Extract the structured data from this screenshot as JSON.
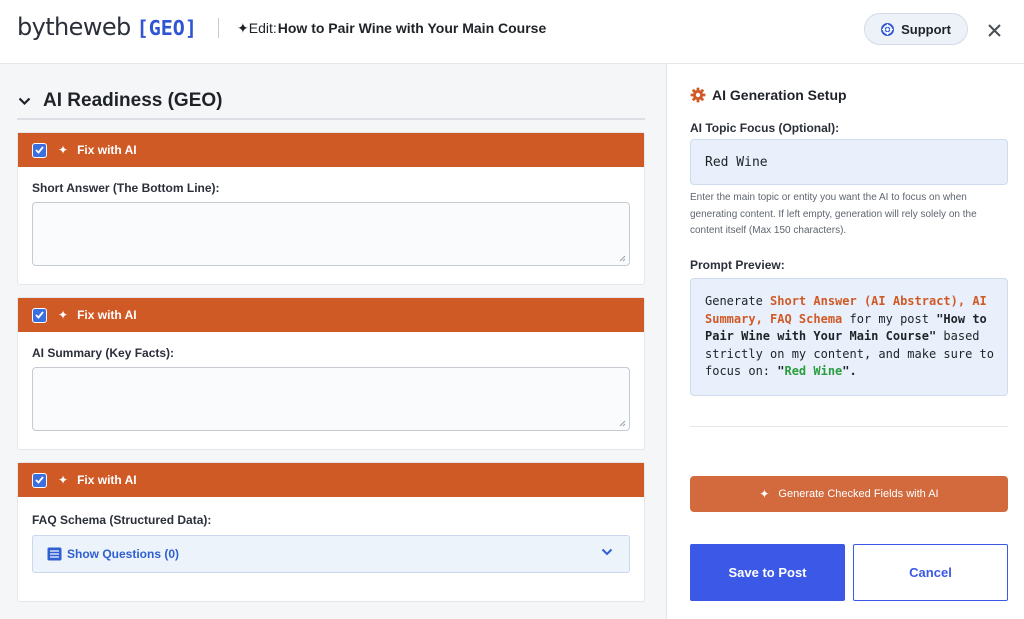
{
  "header": {
    "logo_text": "bytheweb",
    "logo_badge": "[GEO]",
    "title_prefix": "✦Edit:",
    "title": "How to Pair Wine with Your Main Course",
    "support_label": "Support",
    "support_icon": "lifebuoy-icon",
    "close_icon": "close-icon"
  },
  "left": {
    "section_title": "AI Readiness (GEO)",
    "cards": [
      {
        "fix_label": "Fix with AI",
        "checked": true,
        "field_label": "Short Answer (The Bottom Line):",
        "value": ""
      },
      {
        "fix_label": "Fix with AI",
        "checked": true,
        "field_label": "AI Summary (Key Facts):",
        "value": ""
      },
      {
        "fix_label": "Fix with AI",
        "checked": true,
        "field_label": "FAQ Schema (Structured Data):",
        "questions_label": "Show Questions (0)"
      }
    ]
  },
  "right": {
    "title": "AI Generation Setup",
    "topic_label": "AI Topic Focus (Optional):",
    "topic_value": "Red Wine",
    "help_text": "Enter the main topic or entity you want the AI to focus on when generating content. If left empty, generation will rely solely on the content itself (Max 150 characters).",
    "preview_label": "Prompt Preview:",
    "preview": {
      "p1": "Generate ",
      "fields": "Short Answer (AI Abstract), AI Summary, FAQ Schema",
      "p2": " for my post ",
      "post": "\"How to Pair Wine with Your Main Course\"",
      "p3": " based strictly on my content, and make sure to focus on: ",
      "q_open": "\"",
      "topic": "Red Wine",
      "q_close": "\".",
      "p4": ""
    },
    "generate_label": "Generate Checked Fields with AI",
    "save_label": "Save to Post",
    "cancel_label": "Cancel"
  },
  "colors": {
    "accent_orange": "#d05a26",
    "accent_blue": "#3b58e6",
    "highlight_green": "#2a9d3e"
  }
}
